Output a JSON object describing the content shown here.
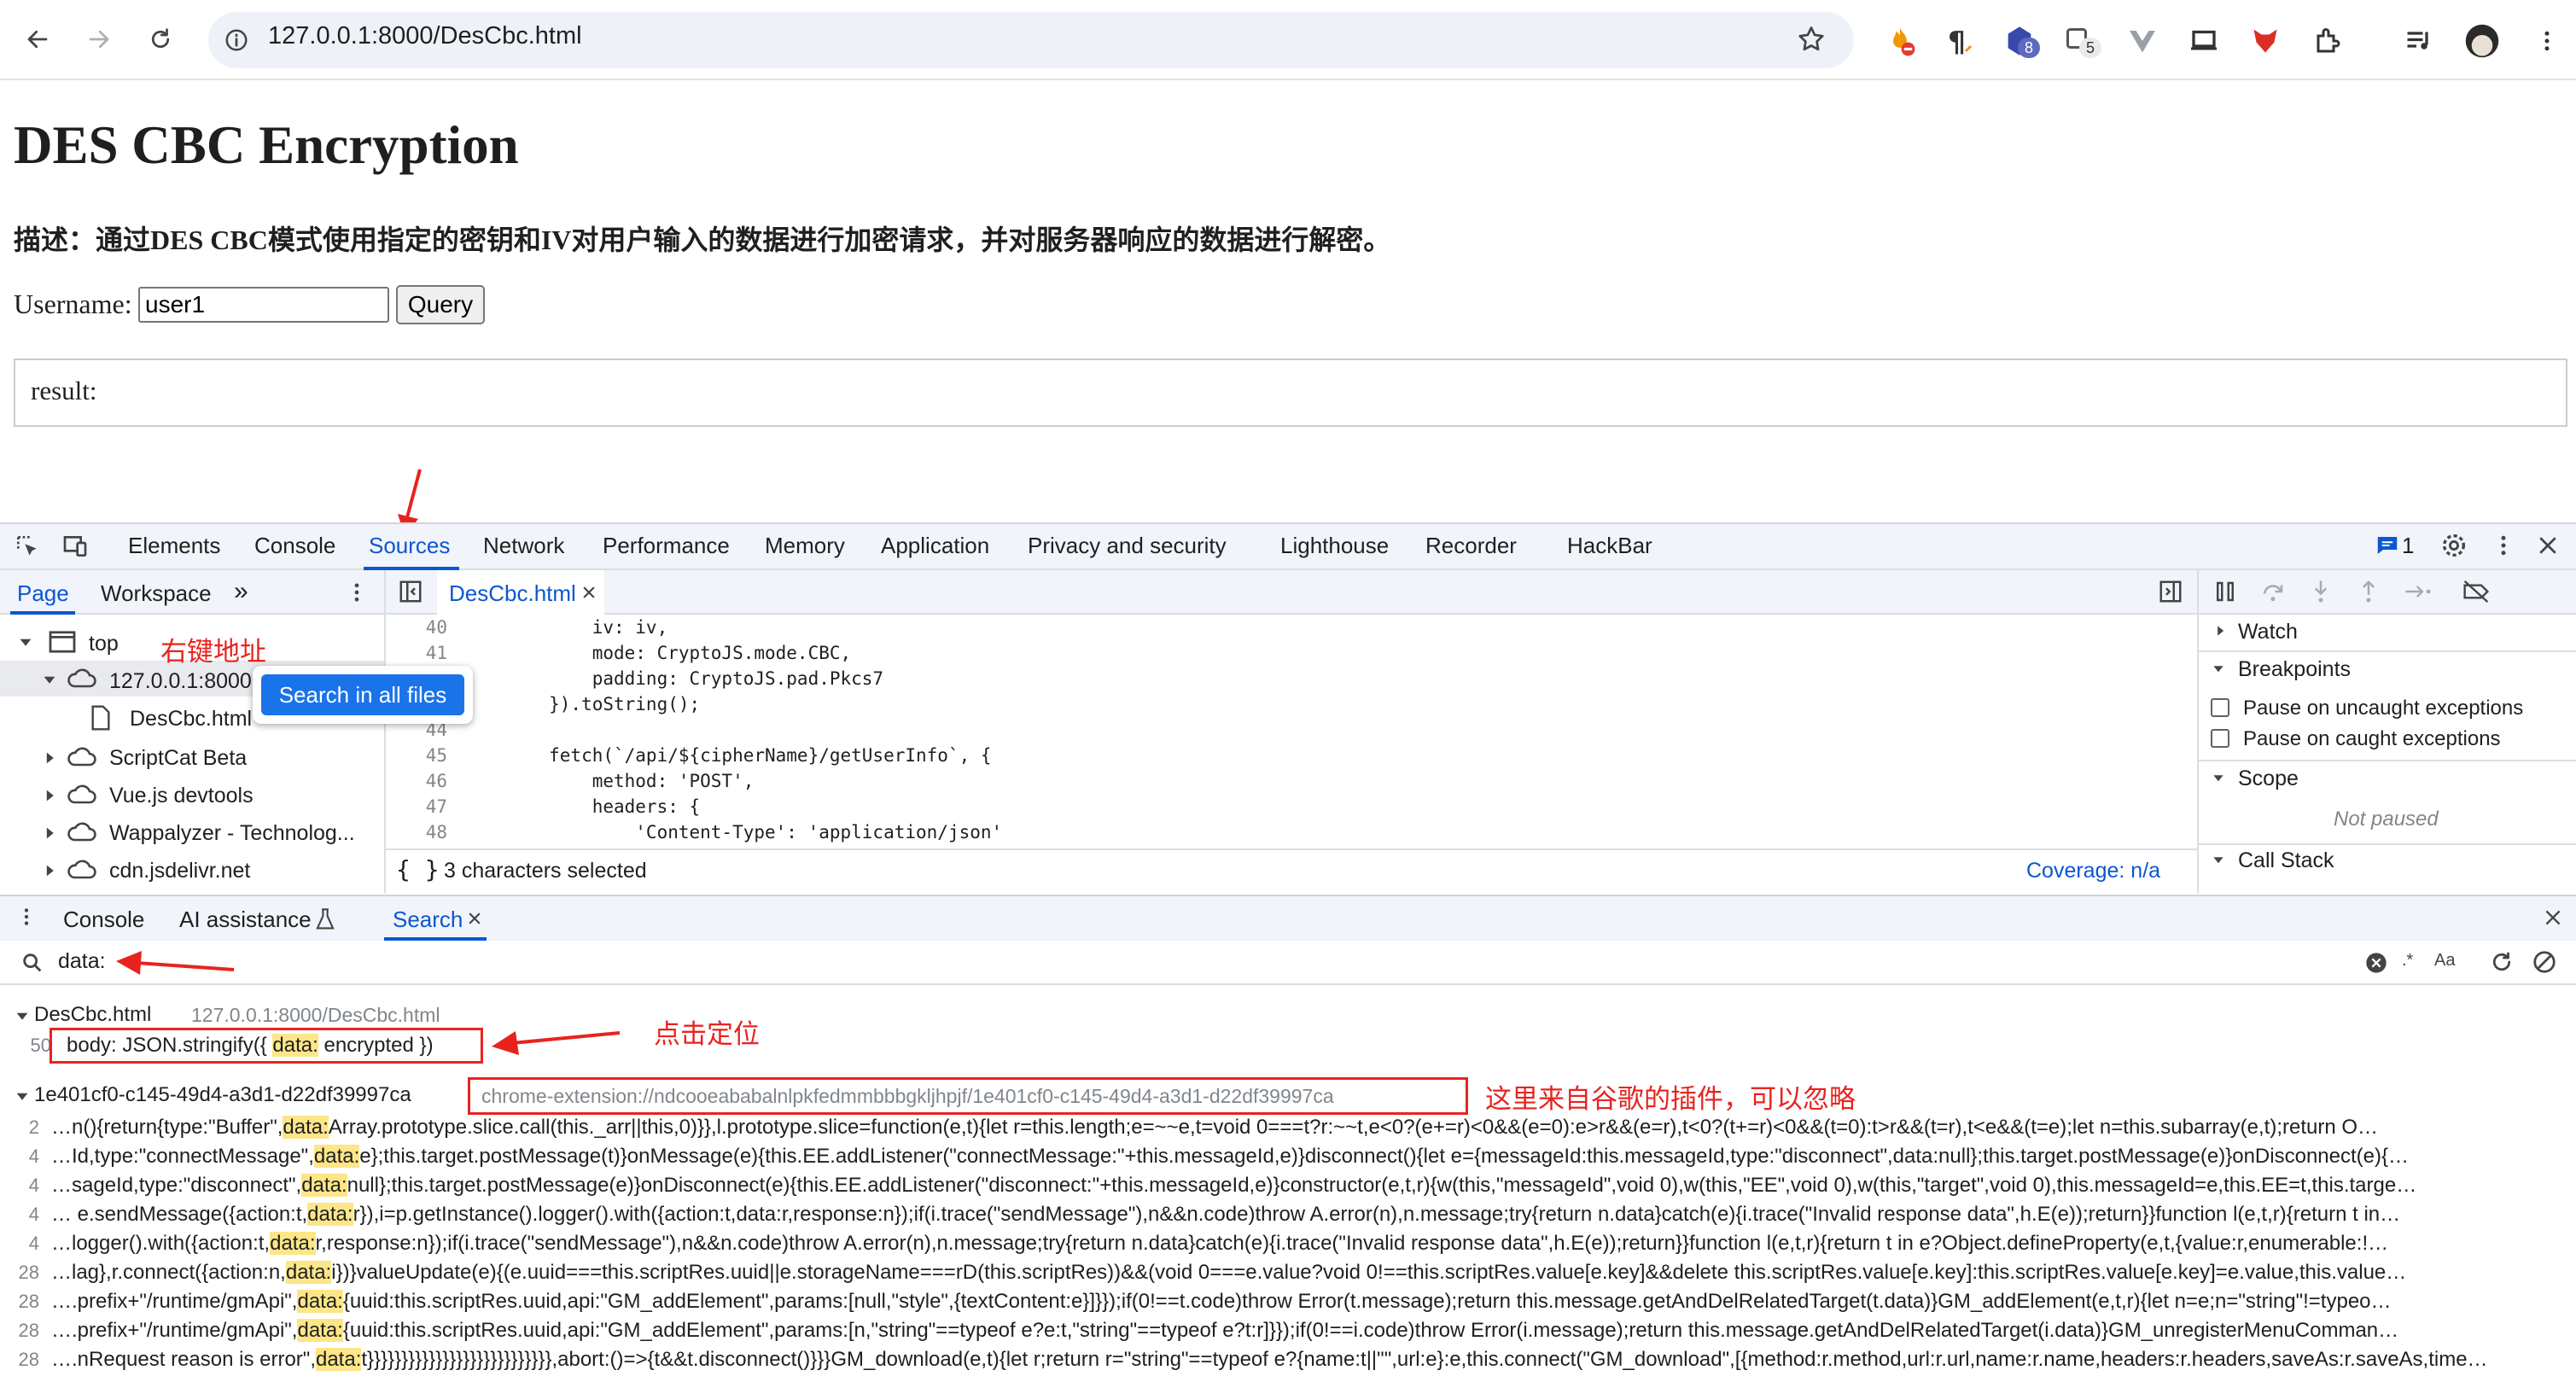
{
  "browser": {
    "url": "127.0.0.1:8000/DesCbc.html",
    "ext_badges": [
      "8",
      "5"
    ]
  },
  "page": {
    "title": "DES CBC Encryption",
    "description": "描述：通过DES CBC模式使用指定的密钥和IV对用户输入的数据进行加密请求，并对服务器响应的数据进行解密。",
    "username_label": "Username:",
    "username_value": "user1",
    "query_label": "Query",
    "result_label": "result:"
  },
  "devtools": {
    "tabs": [
      "Elements",
      "Console",
      "Sources",
      "Network",
      "Performance",
      "Memory",
      "Application",
      "Privacy and security",
      "Lighthouse",
      "Recorder",
      "HackBar"
    ],
    "active_tab": "Sources",
    "issues_count": "1",
    "navigator_tabs": [
      "Page",
      "Workspace"
    ],
    "more_tabs_glyph": "»",
    "tree": {
      "top": "top",
      "origin": "127.0.0.1:8000",
      "file": "DesCbc.html",
      "others": [
        "ScriptCat Beta",
        "Vue.js devtools",
        "Wappalyzer - Technolog...",
        "cdn.jsdelivr.net"
      ]
    },
    "context_menu_item": "Search in all files",
    "editor_tab": "DesCbc.html",
    "code_lines": [
      {
        "n": "40",
        "t": "            iv: iv,"
      },
      {
        "n": "41",
        "t": "            mode: CryptoJS.mode.CBC,"
      },
      {
        "n": "42",
        "t": "            padding: CryptoJS.pad.Pkcs7"
      },
      {
        "n": "43",
        "t": "        }).toString();"
      },
      {
        "n": "44",
        "t": ""
      },
      {
        "n": "45",
        "t": "        fetch(`/api/${cipherName}/getUserInfo`, {"
      },
      {
        "n": "46",
        "t": "            method: 'POST',"
      },
      {
        "n": "47",
        "t": "            headers: {"
      },
      {
        "n": "48",
        "t": "                'Content-Type': 'application/json'"
      }
    ],
    "status_text": "3 characters selected",
    "coverage": "Coverage: n/a",
    "sidebar": {
      "watch": "Watch",
      "breakpoints": "Breakpoints",
      "pause_uncaught": "Pause on uncaught exceptions",
      "pause_caught": "Pause on caught exceptions",
      "scope": "Scope",
      "not_paused": "Not paused",
      "call_stack": "Call Stack"
    },
    "drawer_tabs": [
      "Console",
      "AI assistance",
      "Search"
    ],
    "search_query": "data:",
    "search_options": [
      ".*",
      "Aa"
    ],
    "results": {
      "file1": "DesCbc.html",
      "file1_url": "127.0.0.1:8000/DesCbc.html",
      "file1_line_no": "50",
      "file1_line": {
        "pre": "body: JSON.stringify({ ",
        "match": "data:",
        "post": " encrypted })"
      },
      "file2": "1e401cf0-c145-49d4-a3d1-d22df39997ca",
      "file2_url": "chrome-extension://ndcooeababalnlpkfedmmbbbgkljhpjf/1e401cf0-c145-49d4-a3d1-d22df39997ca",
      "lines": [
        {
          "n": "2",
          "pre": "…n(){return{type:\"Buffer\",",
          "match": "data:",
          "post": "Array.prototype.slice.call(this._arr||this,0)}},l.prototype.slice=function(e,t){let r=this.length;e=~~e,t=void 0===t?r:~~t,e<0?(e+=r)<0&&(e=0):e>r&&(e=r),t<0?(t+=r)<0&&(t=0):t>r&&(t=r),t<e&&(t=e);let n=this.subarray(e,t);return O…"
        },
        {
          "n": "4",
          "pre": "…Id,type:\"connectMessage\",",
          "match": "data:",
          "post": "e};this.target.postMessage(t)}onMessage(e){this.EE.addListener(\"connectMessage:\"+this.messageId,e)}disconnect(){let e={messageId:this.messageId,type:\"disconnect\",data:null};this.target.postMessage(e)}onDisconnect(e){…"
        },
        {
          "n": "4",
          "pre": "…sageId,type:\"disconnect\",",
          "match": "data:",
          "post": "null};this.target.postMessage(e)}onDisconnect(e){this.EE.addListener(\"disconnect:\"+this.messageId,e)}constructor(e,t,r){w(this,\"messageId\",void 0),w(this,\"EE\",void 0),w(this,\"target\",void 0),this.messageId=e,this.EE=t,this.targe…"
        },
        {
          "n": "4",
          "pre": "… e.sendMessage({action:t,",
          "match": "data:",
          "post": "r}),i=p.getInstance().logger().with({action:t,data:r,response:n});if(i.trace(\"sendMessage\"),n&&n.code)throw A.error(n),n.message;try{return n.data}catch(e){i.trace(\"Invalid response data\",h.E(e));return}}function l(e,t,r){return t in…"
        },
        {
          "n": "4",
          "pre": "…logger().with({action:t,",
          "match": "data:",
          "post": "r,response:n});if(i.trace(\"sendMessage\"),n&&n.code)throw A.error(n),n.message;try{return n.data}catch(e){i.trace(\"Invalid response data\",h.E(e));return}}function l(e,t,r){return t in e?Object.defineProperty(e,t,{value:r,enumerable:!…"
        },
        {
          "n": "28",
          "pre": "…lag},r.connect({action:n,",
          "match": "data:",
          "post": "i})}valueUpdate(e){(e.uuid===this.scriptRes.uuid||e.storageName===rD(this.scriptRes))&&(void 0===e.value?void 0!==this.scriptRes.value[e.key]&&delete this.scriptRes.value[e.key]:this.scriptRes.value[e.key]=e.value,this.value…"
        },
        {
          "n": "28",
          "pre": "….prefix+\"/runtime/gmApi\",",
          "match": "data:",
          "post": "{uuid:this.scriptRes.uuid,api:\"GM_addElement\",params:[null,\"style\",{textContent:e}]}});if(0!==t.code)throw Error(t.message);return this.message.getAndDelRelatedTarget(t.data)}GM_addElement(e,t,r){let n=e;n=\"string\"!=typeo…"
        },
        {
          "n": "28",
          "pre": "….prefix+\"/runtime/gmApi\",",
          "match": "data:",
          "post": "{uuid:this.scriptRes.uuid,api:\"GM_addElement\",params:[n,\"string\"==typeof e?e:t,\"string\"==typeof e?t:r]}});if(0!==i.code)throw Error(i.message);return this.message.getAndDelRelatedTarget(i.data)}GM_unregisterMenuComman…"
        },
        {
          "n": "28",
          "pre": "….nRequest reason is error\",",
          "match": "data:",
          "post": "t}}}}}}}}}}}}}}}}}}}}}}}}}}},abort:()=>{t&&t.disconnect()}}}GM_download(e,t){let r;return r=\"string\"==typeof e?{name:t||\"\",url:e}:e,this.connect(\"GM_download\",[{method:r.method,url:r.url,name:r.name,headers:r.headers,saveAs:r.saveAs,time…"
        }
      ]
    },
    "annotations": {
      "right_click": "右键地址",
      "click_locate": "点击定位",
      "ext_note": "这里来自谷歌的插件，可以忽略"
    }
  },
  "colors": {
    "accent": "#1a73e8",
    "annotation": "#e8231f",
    "highlight": "#fce688"
  }
}
